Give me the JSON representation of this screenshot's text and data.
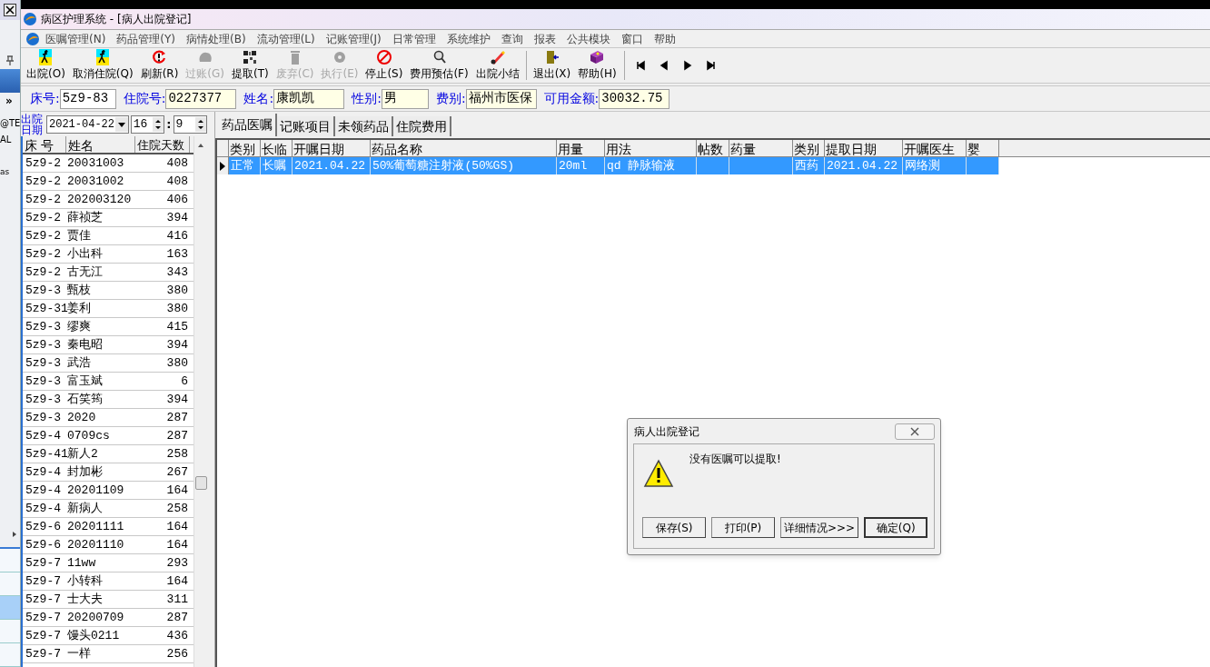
{
  "side_strip": {
    "texts": [
      "»",
      "@TE",
      "AL",
      "as"
    ],
    "rows": [
      {
        "selected": false
      },
      {
        "selected": false
      },
      {
        "selected": true
      },
      {
        "selected": false
      },
      {
        "selected": false
      }
    ]
  },
  "window": {
    "title": "病区护理系统 - [病人出院登记]"
  },
  "menu": [
    "医嘱管理(N)",
    "药品管理(Y)",
    "病情处理(B)",
    "流动管理(L)",
    "记账管理(J)",
    "日常管理",
    "系统维护",
    "查询",
    "报表",
    "公共模块",
    "窗口",
    "帮助"
  ],
  "toolbar": [
    {
      "label": "出院(O)",
      "disabled": false
    },
    {
      "label": "取消住院(Q)",
      "disabled": false
    },
    {
      "label": "刷新(R)",
      "disabled": false
    },
    {
      "label": "过账(G)",
      "disabled": true
    },
    {
      "label": "提取(T)",
      "disabled": false
    },
    {
      "label": "废弃(C)",
      "disabled": true
    },
    {
      "label": "执行(E)",
      "disabled": true
    },
    {
      "label": "停止(S)",
      "disabled": false
    },
    {
      "label": "费用预估(F)",
      "disabled": false
    },
    {
      "label": "出院小结",
      "disabled": false
    },
    {
      "label": "退出(X)",
      "disabled": false
    },
    {
      "label": "帮助(H)",
      "disabled": false
    }
  ],
  "patient": [
    {
      "label": "床号:",
      "value": "5z9-83",
      "highlight": false
    },
    {
      "label": "住院号:",
      "value": "0227377",
      "highlight": true
    },
    {
      "label": "姓名:",
      "value": "康凯凯",
      "highlight": true
    },
    {
      "label": "性别:",
      "value": "男",
      "highlight": true
    },
    {
      "label": "费别:",
      "value": "福州市医保",
      "highlight": true
    },
    {
      "label": "可用金额:",
      "value": "30032.75",
      "highlight": true
    }
  ],
  "discharge": {
    "label": "出院日期",
    "date": "2021-04-22",
    "hour": "16",
    "separator": ":",
    "minute": "9"
  },
  "bed_list": {
    "columns": [
      "床 号",
      "姓名",
      "住院天数"
    ],
    "rows": [
      [
        "5z9-2",
        "20031003",
        "408"
      ],
      [
        "5z9-2",
        "20031002",
        "408"
      ],
      [
        "5z9-2",
        "202003120",
        "406"
      ],
      [
        "5z9-2",
        "薛祯芝",
        "394"
      ],
      [
        "5z9-2",
        "贾佳",
        "416"
      ],
      [
        "5z9-2",
        "小出科",
        "163"
      ],
      [
        "5z9-2",
        "古无江",
        "343"
      ],
      [
        "5z9-3",
        "甄枝",
        "380"
      ],
      [
        "5z9-31",
        "姜利",
        "380"
      ],
      [
        "5z9-3",
        "缪爽",
        "415"
      ],
      [
        "5z9-3",
        "秦电昭",
        "394"
      ],
      [
        "5z9-3",
        "武浩",
        "380"
      ],
      [
        "5z9-3",
        "富玉斌",
        "6"
      ],
      [
        "5z9-3",
        "石笑筠",
        "394"
      ],
      [
        "5z9-3",
        "2020",
        "287"
      ],
      [
        "5z9-4",
        "0709cs",
        "287"
      ],
      [
        "5z9-41",
        "新人2",
        "258"
      ],
      [
        "5z9-4",
        "封加彬",
        "267"
      ],
      [
        "5z9-4",
        "20201109",
        "164"
      ],
      [
        "5z9-4",
        "新病人",
        "258"
      ],
      [
        "5z9-6",
        "20201111",
        "164"
      ],
      [
        "5z9-6",
        "20201110",
        "164"
      ],
      [
        "5z9-7",
        "11ww",
        "293"
      ],
      [
        "5z9-7",
        "小转科",
        "164"
      ],
      [
        "5z9-7",
        "士大夫",
        "311"
      ],
      [
        "5z9-7",
        "20200709",
        "287"
      ],
      [
        "5z9-7",
        "馒头0211",
        "436"
      ],
      [
        "5z9-7",
        "一样",
        "256"
      ]
    ]
  },
  "tabs": [
    {
      "label": "药品医嘱",
      "selected": true
    },
    {
      "label": "记账项目",
      "selected": false
    },
    {
      "label": "未领药品",
      "selected": false
    },
    {
      "label": "住院费用",
      "selected": false
    }
  ],
  "orders": {
    "columns": [
      "类别",
      "长临",
      "开嘱日期",
      "药品名称",
      "用量",
      "用法",
      "帖数",
      "药量",
      "类别",
      "提取日期",
      "开嘱医生",
      "婴"
    ],
    "rows": [
      {
        "selected": true,
        "cells": [
          "正常",
          "长嘱",
          "2021.04.22",
          "50%葡萄糖注射液(50%GS)",
          "20ml",
          "qd 静脉输液",
          "",
          "",
          "西药",
          "2021.04.22",
          "网络测",
          ""
        ]
      }
    ]
  },
  "dialog": {
    "title": "病人出院登记",
    "message": "没有医嘱可以提取!",
    "buttons": [
      {
        "label": "保存(S)",
        "default": false
      },
      {
        "label": "打印(P)",
        "default": false
      },
      {
        "label": "详细情况>>>",
        "default": false
      },
      {
        "label": "确定(Q)",
        "default": true
      }
    ]
  }
}
